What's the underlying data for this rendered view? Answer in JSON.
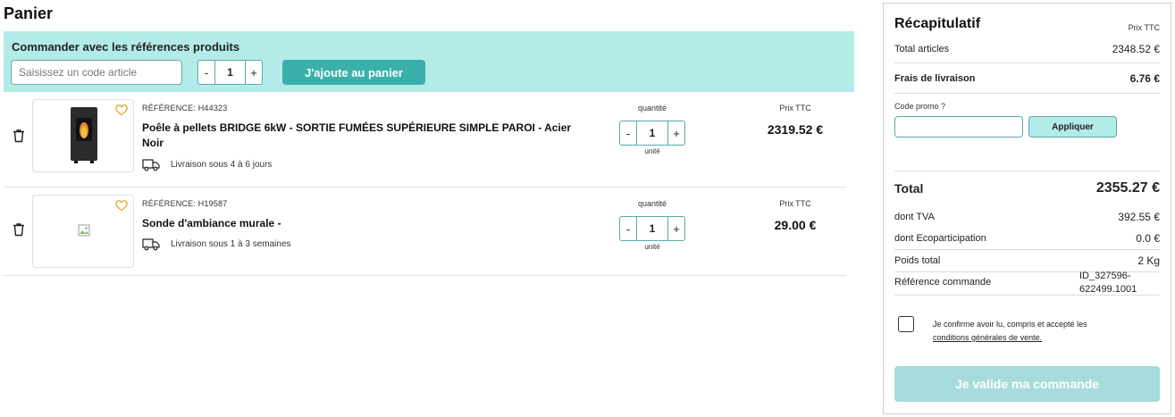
{
  "page": {
    "title": "Panier"
  },
  "quick_order": {
    "title": "Commander avec les références produits",
    "input_placeholder": "Saisissez un code article",
    "qty_minus": "-",
    "qty_value": "1",
    "qty_plus": "+",
    "add_button": "J'ajoute au panier"
  },
  "items": [
    {
      "reference": "RÉFÉRENCE: H44323",
      "name": "Poêle à pellets BRIDGE 6kW - SORTIE FUMÉES SUPÉRIEURE SIMPLE PAROI - Acier Noir",
      "delivery": "Livraison sous 4 à 6 jours",
      "qty_label": "quantité",
      "qty_minus": "-",
      "qty": "1",
      "qty_plus": "+",
      "unit": "unité",
      "price_label": "Prix TTC",
      "price": "2319.52 €"
    },
    {
      "reference": "RÉFÉRENCE: H19587",
      "name": "Sonde d'ambiance murale -",
      "delivery": "Livraison sous 1 à 3 semaines",
      "qty_label": "quantité",
      "qty_minus": "-",
      "qty": "1",
      "qty_plus": "+",
      "unit": "unité",
      "price_label": "Prix TTC",
      "price": "29.00 €"
    }
  ],
  "summary": {
    "title": "Récapitulatif",
    "price_type": "Prix TTC",
    "total_articles_label": "Total articles",
    "total_articles_value": "2348.52 €",
    "shipping_label": "Frais de livraison",
    "shipping_value": "6.76 €",
    "promo_label": "Code promo ?",
    "promo_button": "Appliquer",
    "total_label": "Total",
    "total_value": "2355.27 €",
    "vat_label": "dont TVA",
    "vat_value": "392.55 €",
    "eco_label": "dont Ecoparticipation",
    "eco_value": "0.0 €",
    "weight_label": "Poids total",
    "weight_value": "2 Kg",
    "order_ref_label": "Référence commande",
    "order_ref_value": "ID_327596-622499.1001",
    "cgv_text": "Je confirme avoir lu, compris et accepté les",
    "cgv_link": "conditions générales de vente.",
    "validate_button": "Je valide ma commande"
  },
  "colors": {
    "accent": "#3ab0aa",
    "accent_light": "#b3ebe8",
    "validate_disabled": "#a7dcdc",
    "heart": "#e0a92e"
  },
  "icons": [
    "trash-icon",
    "heart-icon",
    "delivery-truck-icon",
    "broken-image-icon"
  ]
}
